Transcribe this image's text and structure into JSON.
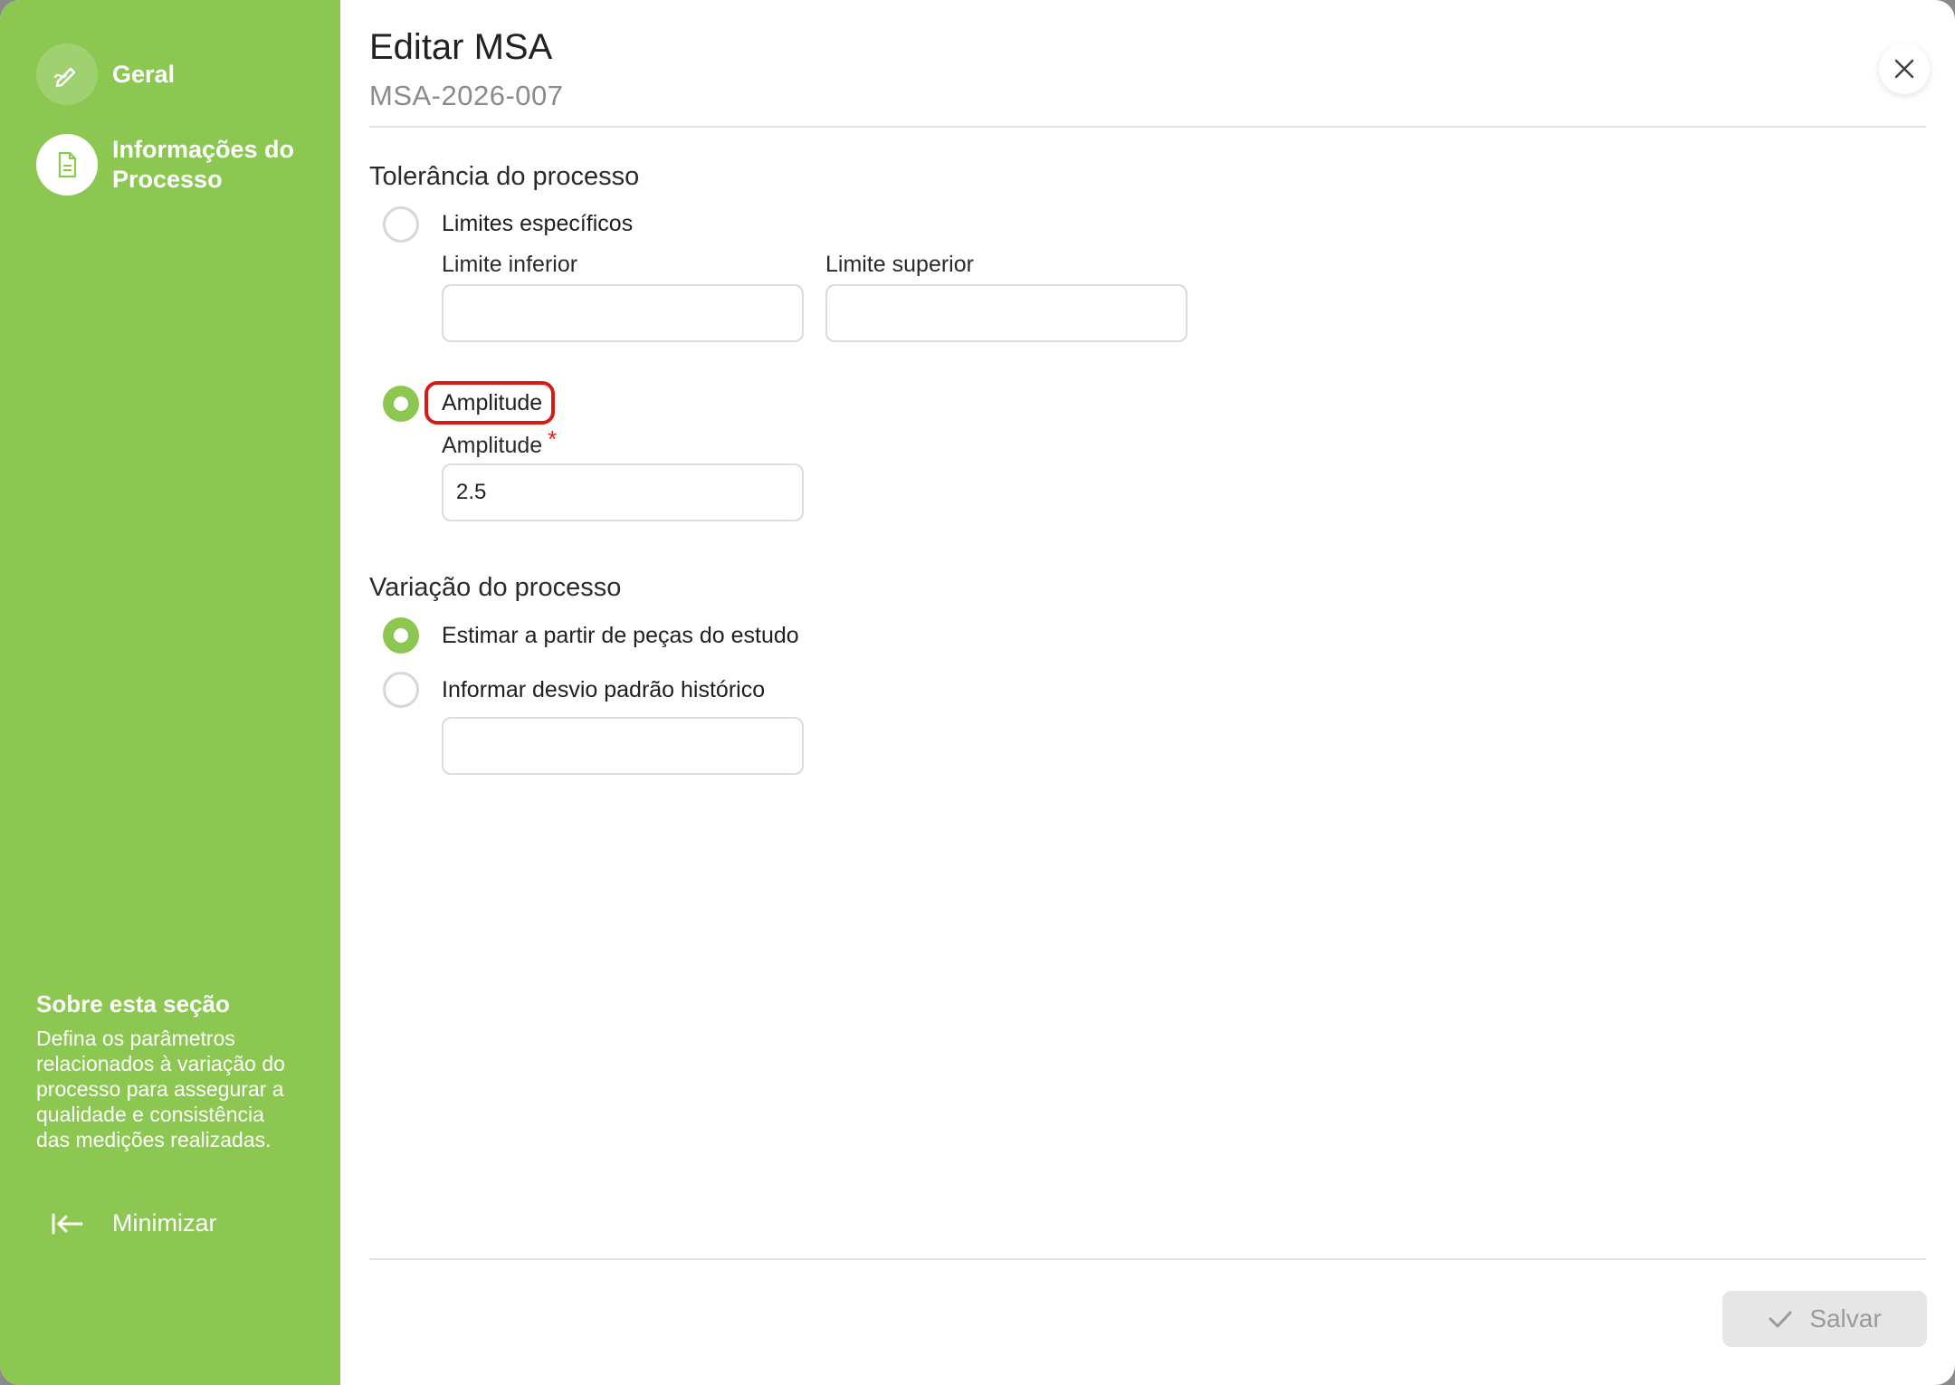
{
  "sidebar": {
    "steps": [
      {
        "label": "Geral",
        "state": "done",
        "icon": "pencil-icon"
      },
      {
        "label": "Informações do\nProcesso",
        "state": "active",
        "icon": "document-icon"
      }
    ],
    "about_title": "Sobre esta seção",
    "about_text": "Defina os parâmetros relacionados à variação do processo para assegurar a qualidade e consistência das medições realizadas.",
    "minimize_label": "Minimizar"
  },
  "header": {
    "title": "Editar MSA",
    "subtitle": "MSA-2026-007"
  },
  "tolerance": {
    "title": "Tolerância do processo",
    "option_limits": "Limites específicos",
    "lower_label": "Limite inferior",
    "lower_value": "",
    "upper_label": "Limite superior",
    "upper_value": "",
    "option_amplitude": "Amplitude",
    "amplitude_label": "Amplitude",
    "amplitude_required": "*",
    "amplitude_value": "2.5",
    "selected": "amplitude"
  },
  "variation": {
    "title": "Variação do processo",
    "option_estimate": "Estimar a partir de peças do estudo",
    "option_historic": "Informar desvio padrão histórico",
    "historic_value": "",
    "selected": "estimate"
  },
  "footer": {
    "save_label": "Salvar"
  },
  "colors": {
    "accent": "#8cc751",
    "highlight": "#d81a12",
    "required": "#e0261c"
  }
}
